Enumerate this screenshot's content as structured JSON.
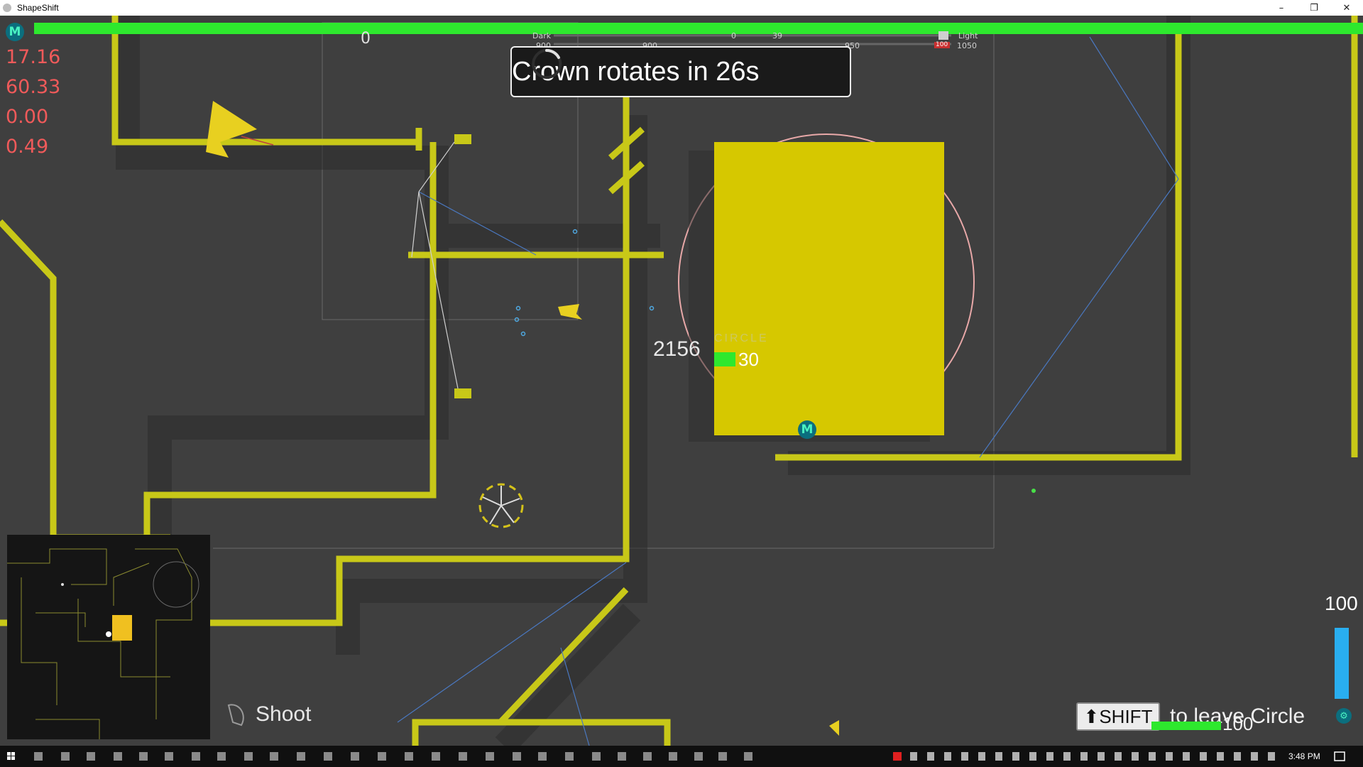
{
  "window": {
    "title": "ShapeShift",
    "minimize": "–",
    "restore": "❐",
    "close": "✕"
  },
  "hud": {
    "player_badge": "M",
    "team_badge": "M",
    "stats": [
      "17.16",
      "60.33",
      "0.00",
      "0.49"
    ],
    "crown_message": "Crown rotates in 26s",
    "balance": {
      "left_label": "Dark",
      "right_label": "Light",
      "left_count": "0",
      "mid_count": "0",
      "right_count": "39",
      "left_score": "900",
      "mid_score": "900",
      "right_score": "950",
      "max_score": "1050",
      "light_badge": "100"
    },
    "damage_number": "2156",
    "zone_label": "CIRCLE",
    "capture_value": "30",
    "shoot_label": "Shoot",
    "shift_key": "SHIFT",
    "leave_text": "to leave Circle",
    "bottom_value": "100",
    "ammo_value": "100",
    "ammo_fraction": 1.0,
    "colors": {
      "health": "#2ee82e",
      "wall": "#c8c818",
      "crown_block": "#d6c800",
      "ammo": "#29aef0",
      "stats": "#f05a5a"
    }
  },
  "taskbar": {
    "time": "3:48 PM"
  }
}
